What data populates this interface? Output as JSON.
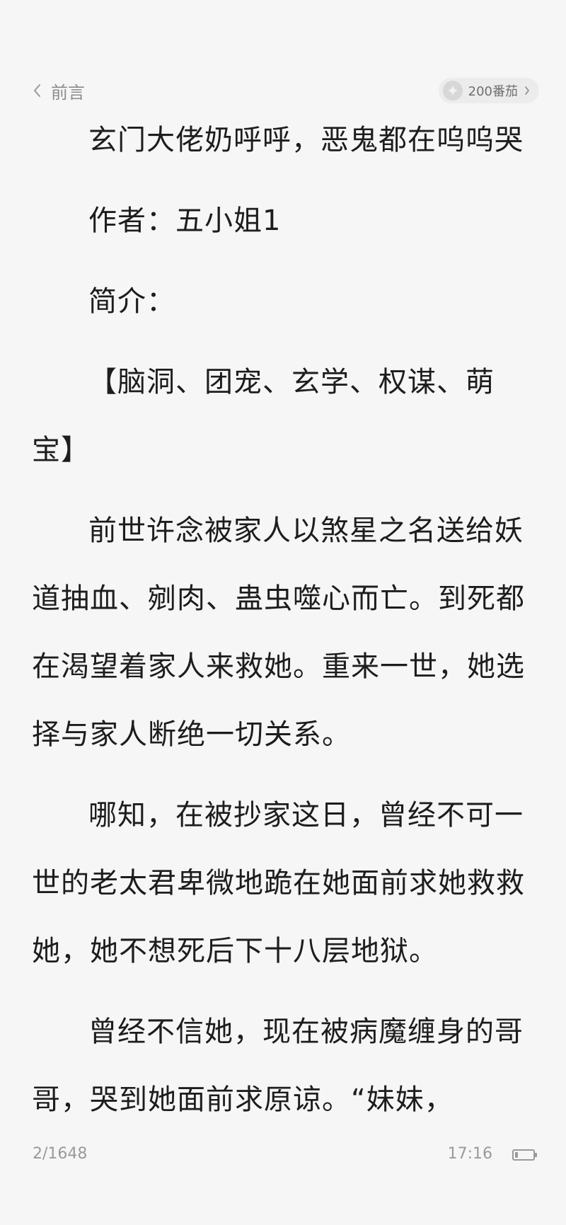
{
  "header": {
    "back_label": "前言",
    "coin_label": "200番茄"
  },
  "content": {
    "paragraphs": [
      "玄门大佬奶呼呼，恶鬼都在呜呜哭",
      "作者：五小姐1",
      "简介：",
      "【脑洞、团宠、玄学、权谋、萌宝】",
      "前世许念被家人以煞星之名送给妖道抽血、剜肉、蛊虫噬心而亡。到死都在渴望着家人来救她。重来一世，她选择与家人断绝一切关系。",
      "哪知，在被抄家这日，曾经不可一世的老太君卑微地跪在她面前求她救救她，她不想死后下十八层地狱。",
      "曾经不信她，现在被病魔缠身的哥哥，哭到她面前求原谅。“妹妹，"
    ]
  },
  "footer": {
    "page_indicator": "2/1648",
    "time": "17:16",
    "battery_level": 0.15
  },
  "icons": {
    "back": "chevron-left-icon",
    "coin": "sparkle-icon",
    "coin_more": "chevron-right-icon",
    "battery": "battery-icon"
  }
}
